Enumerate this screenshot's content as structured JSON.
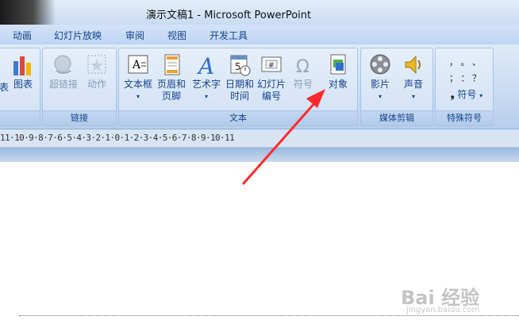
{
  "window": {
    "title": "演示文稿1 - Microsoft PowerPoint"
  },
  "tabs": [
    "动画",
    "幻灯片放映",
    "审阅",
    "视图",
    "开发工具"
  ],
  "ribbon": {
    "groups": {
      "illustrations_partial": {
        "chart_label": "图表",
        "side_label": "表"
      },
      "links": {
        "label": "链接",
        "hyperlink": "超链接",
        "action": "动作"
      },
      "text": {
        "label": "文本",
        "textbox": "文本框",
        "header_footer_1": "页眉和",
        "header_footer_2": "页脚",
        "wordart": "艺术字",
        "datetime_1": "日期和",
        "datetime_2": "时间",
        "slidenum_1": "幻灯片",
        "slidenum_2": "编号",
        "symbol": "符号",
        "object": "对象"
      },
      "media": {
        "label": "媒体剪辑",
        "movie": "影片",
        "sound": "声音"
      },
      "special": {
        "label": "特殊符号",
        "symbol": "符号",
        "row1": "，  。  、",
        "row2": "；  ：  ？"
      }
    }
  },
  "ruler": {
    "text": "11·10·9·8·7·6·5·4·3·2·1·0·1·2·3·4·5·6·7·8·9·10·11"
  },
  "watermark": {
    "main": "Bai 经验",
    "sub": "jingyan.baidu.com"
  },
  "colors": {
    "annotation_arrow": "#ff2a2a",
    "ribbon_text": "#15428b"
  }
}
